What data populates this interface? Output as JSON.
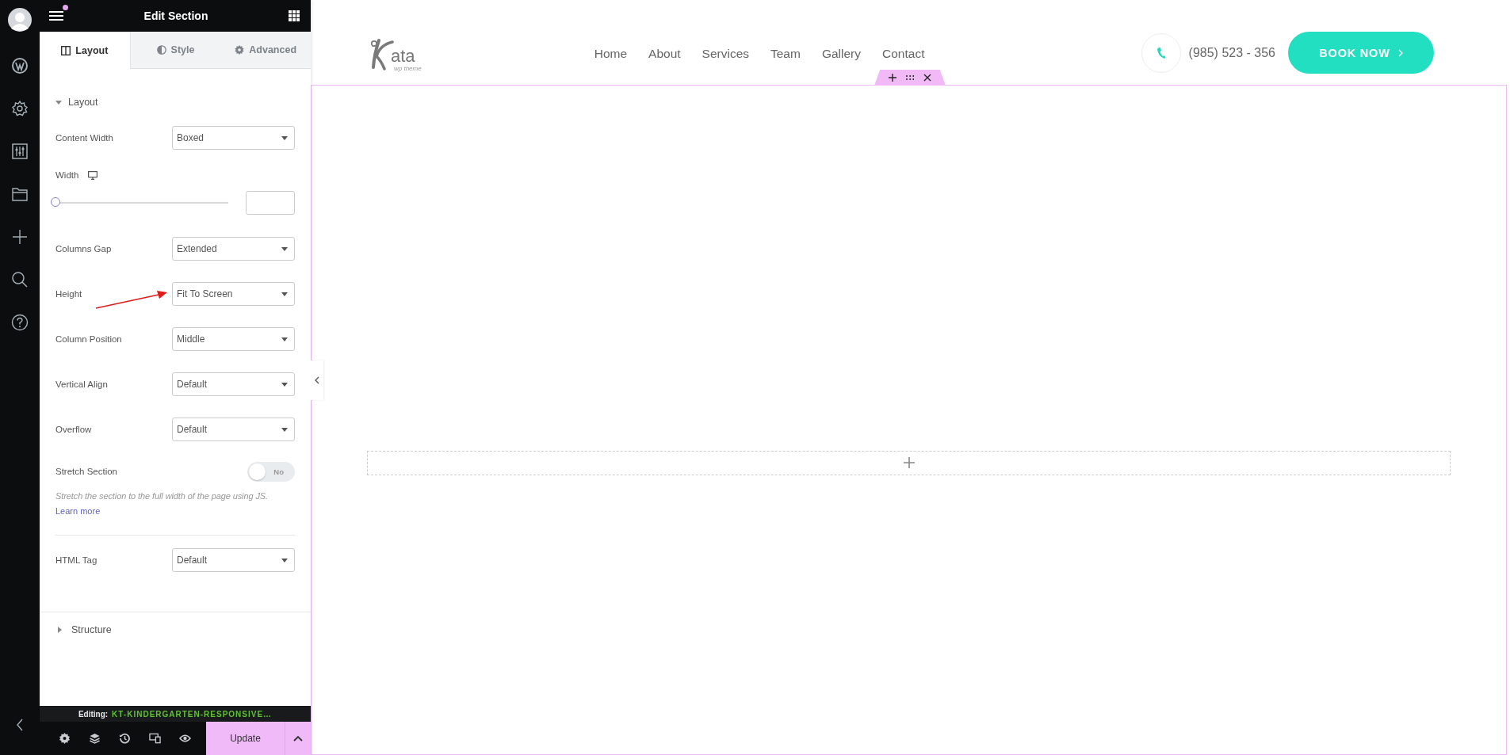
{
  "top_bar": {
    "title": "Edit Section"
  },
  "tabs": [
    {
      "label": "Layout",
      "kind": "columns",
      "selected": true
    },
    {
      "label": "Style",
      "kind": "contrast",
      "selected": false
    },
    {
      "label": "Advanced",
      "kind": "gear",
      "selected": false
    }
  ],
  "layout_section": {
    "title": "Layout",
    "expanded": true,
    "controls": [
      {
        "kind": "select",
        "label": "Content Width",
        "value": "Boxed"
      },
      {
        "kind": "slider",
        "label": "Width",
        "level": 0
      },
      {
        "kind": "select",
        "label": "Columns Gap",
        "value": "Extended"
      },
      {
        "kind": "select",
        "label": "Height",
        "value": "Fit To Screen",
        "annotated": true
      },
      {
        "kind": "select",
        "label": "Column Position",
        "value": "Middle"
      },
      {
        "kind": "select",
        "label": "Vertical Align",
        "value": "Default"
      },
      {
        "kind": "select",
        "label": "Overflow",
        "value": "Default"
      },
      {
        "kind": "toggle",
        "label": "Stretch Section",
        "on": false,
        "state_label": "No",
        "description": "Stretch the section to the full width of the page using JS.",
        "link": "Learn more"
      },
      {
        "kind": "divider"
      },
      {
        "kind": "select",
        "label": "HTML Tag",
        "value": "Default"
      }
    ]
  },
  "structure_section": {
    "title": "Structure",
    "expanded": false
  },
  "footer": {
    "editing_label": "Editing:",
    "document": "KT-KINDERGARTEN-RESPONSIVE…",
    "update": "Update"
  },
  "site_header": {
    "logo": {
      "text": "ata",
      "tagline": "wp theme"
    },
    "nav": [
      "Home",
      "About",
      "Services",
      "Team",
      "Gallery",
      "Contact"
    ],
    "phone": "(985) 523 - 356",
    "cta": "BOOK NOW"
  }
}
